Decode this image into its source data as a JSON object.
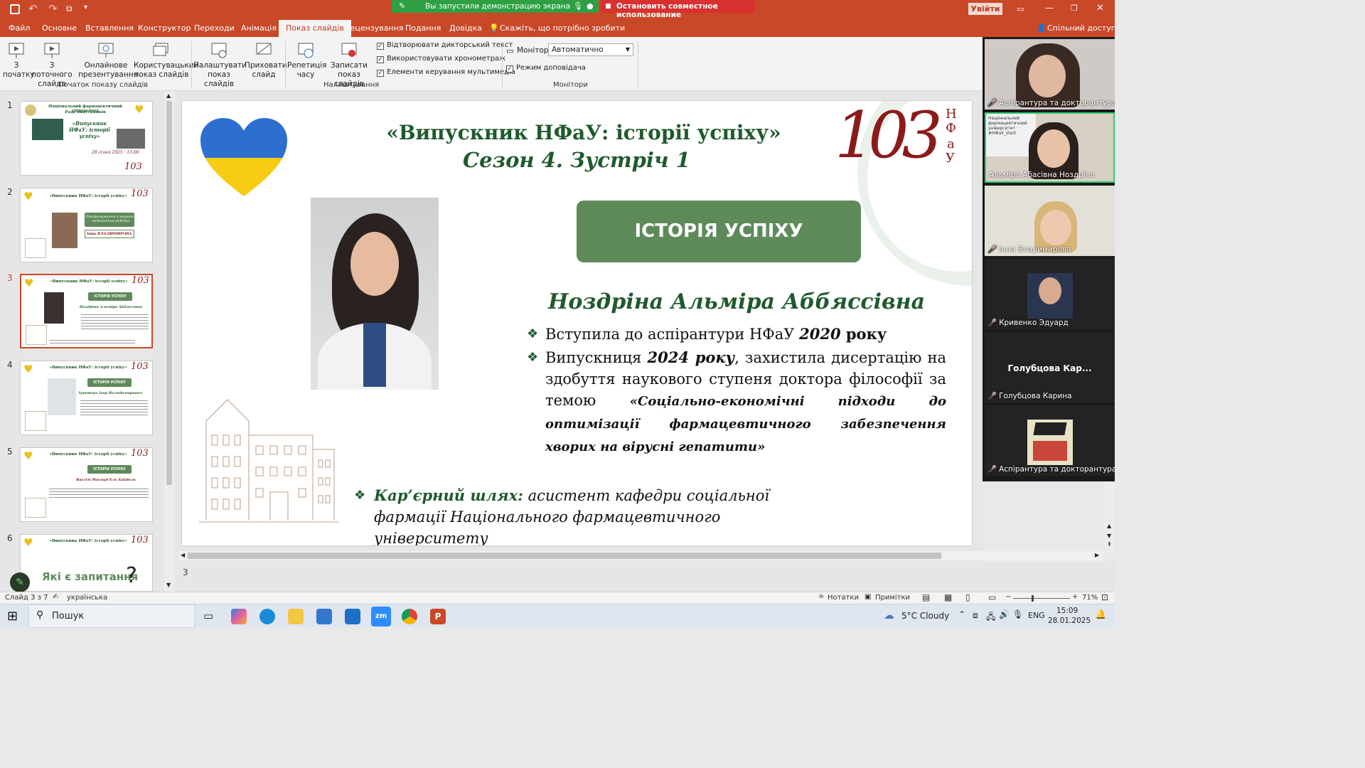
{
  "titlebar": {
    "share_banner": "Вы запустили демонстрацию экрана",
    "stop_share": "Остановить совместное использование",
    "signin": "Увійти"
  },
  "ribbon_tabs": [
    "Файл",
    "Основне",
    "Вставлення",
    "Конструктор",
    "Переходи",
    "Анімація",
    "Показ слайдів",
    "Рецензування",
    "Подання",
    "Довідка"
  ],
  "ribbon_search": "Скажіть, що потрібно зробити",
  "ribbon_share": "Спільний доступ",
  "ribbon": {
    "from_start": "З початку",
    "from_current": "З поточного слайда",
    "online": "Онлайнове презентування",
    "custom": "Користувацький показ слайдів",
    "group_start": "Початок показу слайдів",
    "setup": "Налаштувати показ слайдів",
    "hide": "Приховати слайд",
    "rehearse": "Репетиція часу",
    "record": "Записати показ слайдів",
    "chk_narration": "Відтворювати дикторський текст",
    "chk_timings": "Використовувати хронометраж",
    "chk_media": "Елементи керування мультимедіа",
    "group_setup": "Налаштування",
    "monitor_label": "Монітор:",
    "monitor_value": "Автоматично",
    "chk_presenter": "Режим доповідача",
    "group_monitors": "Монітори"
  },
  "thumbnails": [
    {
      "num": "1",
      "title": "Національний фармацевтичний університет",
      "subtitle": "Рада випускників",
      "extra": "28 січня 2025 · 15:00"
    },
    {
      "num": "2",
      "title": "«Випускник НФаУ: історії успіху»",
      "subtitle": "Інна ВЛАДИМИРОВА",
      "extra": "Програмування з наукою – педагогічна робота"
    },
    {
      "num": "3",
      "title": "«Випускник НФаУ: історії успіху»",
      "subtitle": "Ноздріна Альміра Аббяссівна",
      "extra": "ІСТОРІЯ УСПІХУ"
    },
    {
      "num": "4",
      "title": "«Випускник НФаУ: історії успіху»",
      "subtitle": "Зупанець Ігор Володимирович",
      "extra": "ІСТОРІЯ УСПІХУ"
    },
    {
      "num": "5",
      "title": "«Випускник НФаУ: історії успіху»",
      "subtitle": "Вассім Махмуд Ель Хайдоль",
      "extra": "ІСТОРІЯ УСПІХУ"
    },
    {
      "num": "6",
      "title": "«Випускник НФаУ: історії успіху»",
      "subtitle": "Які є запитання",
      "extra": "?"
    }
  ],
  "slide": {
    "title": "«Випускник НФаУ: історії успіху»",
    "subtitle": "Сезон 4. Зустріч 1",
    "logo_num": "103",
    "logo_letters": [
      "Н",
      "Ф",
      "а",
      "У"
    ],
    "badge": "ІСТОРІЯ УСПІХУ",
    "person": "Ноздріна Альміра Аббяссівна",
    "bullet1_a": "Вступила до аспірантури НФаУ ",
    "bullet1_b": "2020",
    "bullet1_c": " року",
    "bullet2_a": "Випускниця ",
    "bullet2_b": "2024 року",
    "bullet2_c": ", захистила дисертацію на здобуття наукового ступеня доктора філософії за темою ",
    "bullet2_d": "«Соціально-економічні підходи до оптимізації фармацевтичного забезпечення хворих на вірусні гепатити»",
    "career_label": "Кар’єрний шлях:",
    "career_text": " асистент кафедри соціальної фармації Національного фармацевтичного університету"
  },
  "video_tiles": [
    {
      "name": "Аспірантура та докторантура Н...",
      "muted": true
    },
    {
      "name": "Альміра Абасівна Ноздріна",
      "muted": false
    },
    {
      "name": "Інна Владимирова",
      "muted": true
    },
    {
      "name": "Кривенко Эдуард",
      "muted": true
    },
    {
      "name": "Голубцова Карина",
      "muted": true,
      "center": "Голубцова  Кар..."
    },
    {
      "name": "Аспірантура та докторантура Н...",
      "muted": true
    }
  ],
  "notes_placeholder": "3",
  "status": {
    "slide_of": "Слайд 3 з 7",
    "language": "українська",
    "notes": "Нотатки",
    "comments": "Примітки",
    "zoom": "71%"
  },
  "taskbar": {
    "search": "Пошук",
    "weather": "5°C  Cloudy",
    "lang": "ENG",
    "time": "15:09",
    "date": "28.01.2025"
  },
  "colors": {
    "accent": "#c94828",
    "green": "#5e8a5a",
    "dark_green": "#1f5a2c",
    "burgundy": "#8b1a1a"
  }
}
